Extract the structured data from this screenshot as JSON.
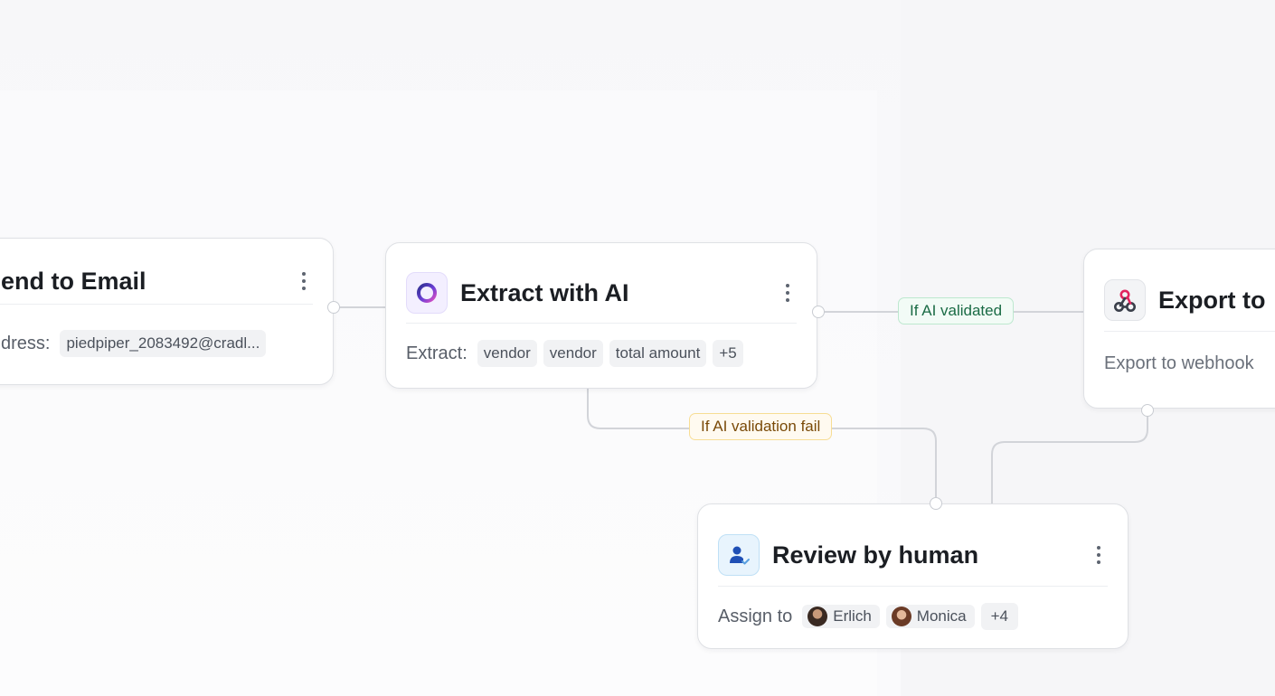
{
  "nodes": {
    "send_email": {
      "title": "end to Email",
      "field_label": "dress:",
      "field_value": "piedpiper_2083492@cradl..."
    },
    "extract_ai": {
      "title": "Extract with AI",
      "field_label": "Extract:",
      "chips": [
        "vendor",
        "vendor",
        "total amount",
        "+5"
      ]
    },
    "export": {
      "title": "Export to",
      "description": "Export to webhook"
    },
    "review": {
      "title": "Review by human",
      "field_label": "Assign to",
      "assignees": [
        "Erlich",
        "Monica"
      ],
      "more_count": "+4"
    }
  },
  "edges": {
    "validated_label": "If AI validated",
    "failed_label": "If AI validation fail"
  },
  "icons": {
    "extract_ai": "ai-ring-icon",
    "export": "webhook-icon",
    "review": "user-check-icon",
    "menu": "more-vertical-icon"
  },
  "colors": {
    "success_label": "#1a6b45",
    "warning_label": "#7a4a08",
    "webhook_accent": "#e2245e",
    "user_accent": "#1f4fb5",
    "ai_accent": "#6b3fd6"
  }
}
